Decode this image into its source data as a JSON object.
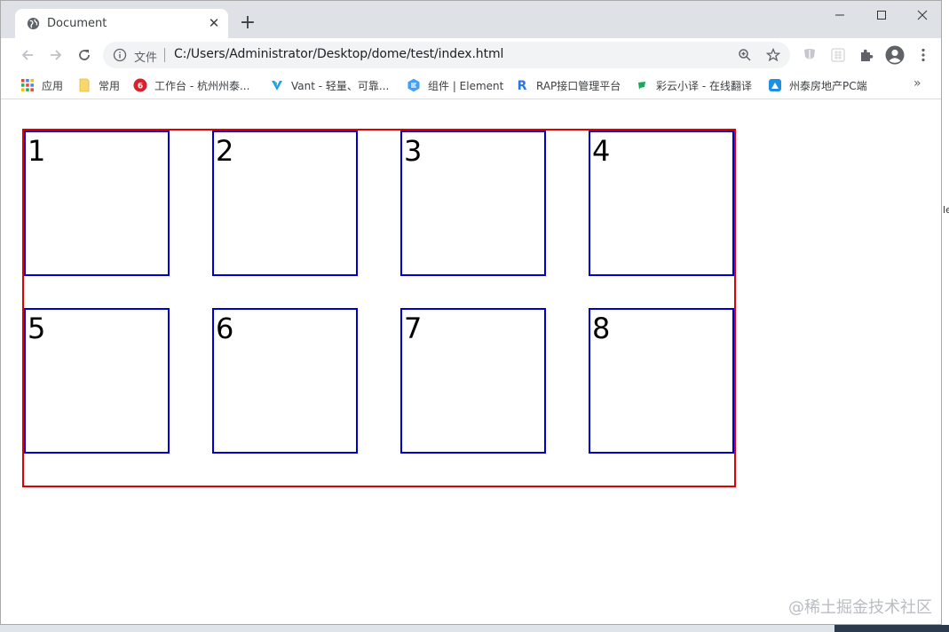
{
  "browser": {
    "tab": {
      "title": "Document",
      "favicon": "globe-icon",
      "close": "✕"
    },
    "new_tab": "+",
    "window_controls": [
      "minimize-icon",
      "maximize-icon",
      "close-icon"
    ]
  },
  "toolbar": {
    "security_label": "文件",
    "url": "C:/Users/Administrator/Desktop/dome/test/index.html",
    "icons": [
      "back-icon",
      "forward-icon",
      "reload-icon",
      "zoom-icon",
      "star-icon",
      "extension-shield-icon",
      "extension-grid-icon",
      "puzzle-icon",
      "profile-icon",
      "menu-icon"
    ]
  },
  "bookmarks": {
    "items": [
      {
        "label": "应用",
        "icon": "apps-grid-icon"
      },
      {
        "label": "常用",
        "icon": "folder-icon"
      },
      {
        "label": "工作台 - 杭州州泰...",
        "icon": "red-logo-icon"
      },
      {
        "label": "Vant - 轻量、可靠...",
        "icon": "vant-logo-icon"
      },
      {
        "label": "组件 | Element",
        "icon": "element-logo-icon"
      },
      {
        "label": "RAP接口管理平台",
        "icon": "rap-logo-icon"
      },
      {
        "label": "彩云小译 - 在线翻译",
        "icon": "caiyun-logo-icon"
      },
      {
        "label": "州泰房地产PC端",
        "icon": "house-logo-icon"
      }
    ],
    "more": "»"
  },
  "page": {
    "boxes": [
      "1",
      "2",
      "3",
      "4",
      "5",
      "6",
      "7",
      "8"
    ],
    "colors": {
      "outer_border": "#e00000",
      "inner_border": "#0000cc"
    }
  },
  "side_peek": "le",
  "watermark": "@稀土掘金技术社区"
}
